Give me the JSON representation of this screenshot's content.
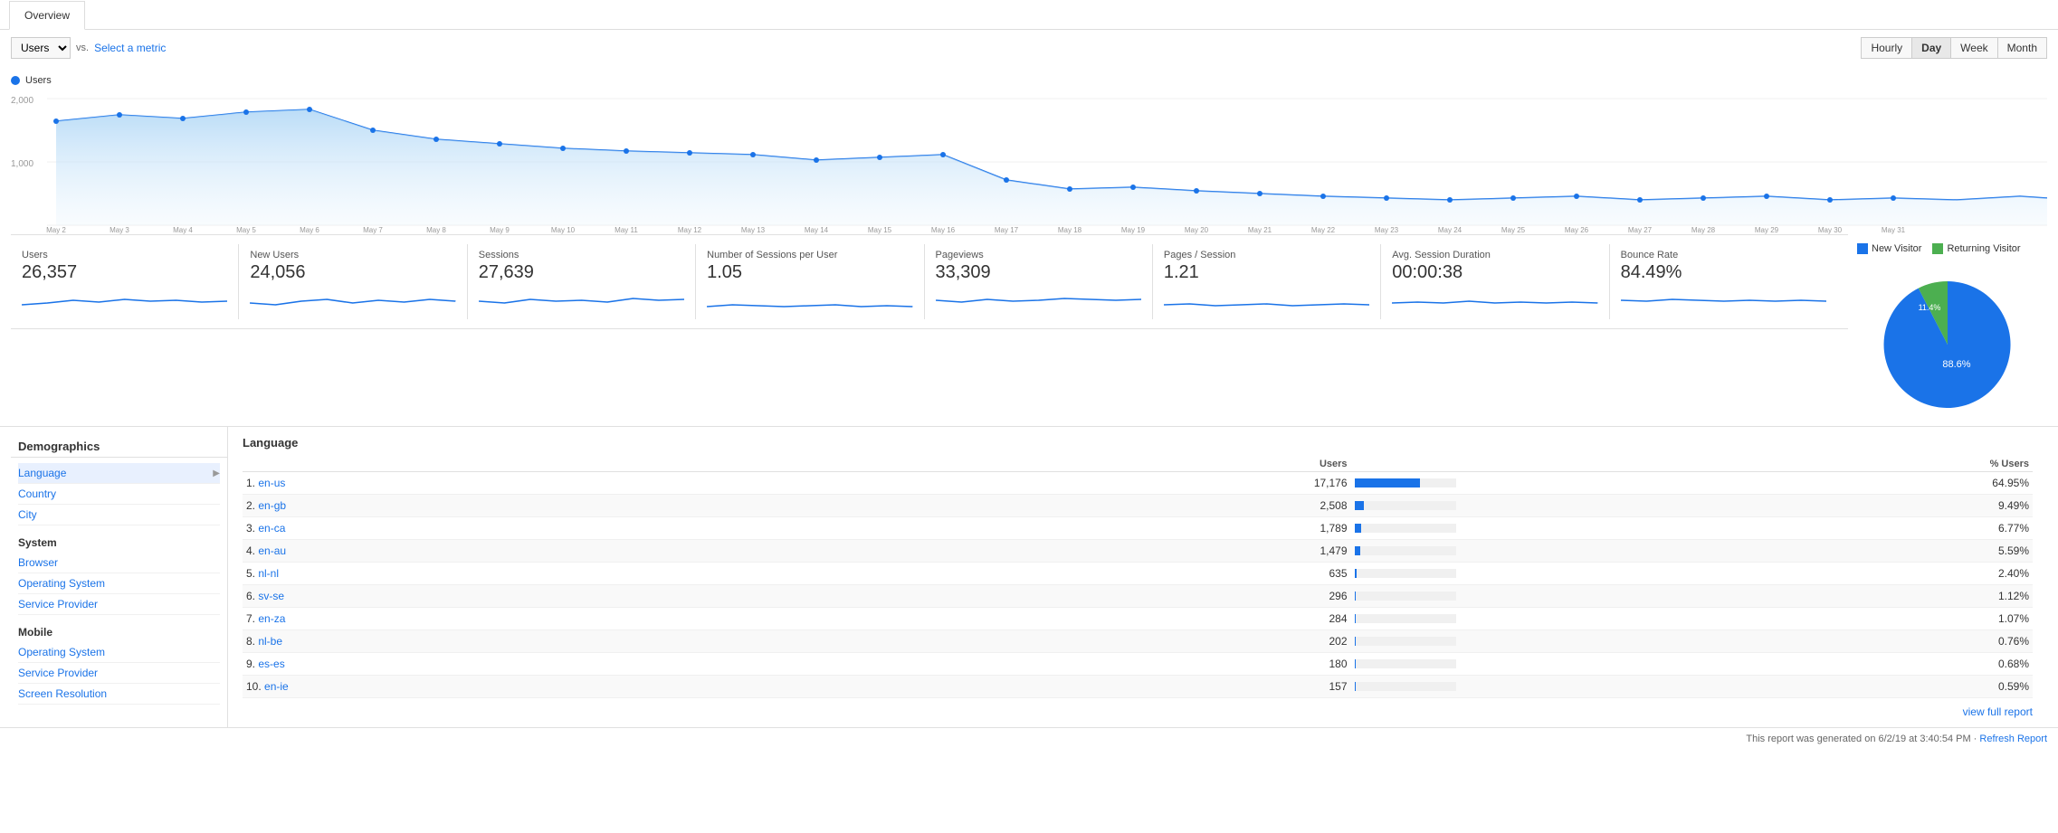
{
  "tabs": [
    {
      "label": "Overview",
      "active": true
    }
  ],
  "metric_selector": {
    "primary": "Users",
    "vs_label": "vs.",
    "select_metric_label": "Select a metric"
  },
  "time_buttons": [
    {
      "label": "Hourly",
      "active": false
    },
    {
      "label": "Day",
      "active": true
    },
    {
      "label": "Week",
      "active": false
    },
    {
      "label": "Month",
      "active": false
    }
  ],
  "chart": {
    "legend_label": "Users",
    "y_labels": [
      "2,000",
      "1,000"
    ],
    "x_labels": [
      "May 2",
      "May 3",
      "May 4",
      "May 5",
      "May 6",
      "May 7",
      "May 8",
      "May 9",
      "May 10",
      "May 11",
      "May 12",
      "May 13",
      "May 14",
      "May 15",
      "May 16",
      "May 17",
      "May 18",
      "May 19",
      "May 20",
      "May 21",
      "May 22",
      "May 23",
      "May 24",
      "May 25",
      "May 26",
      "May 27",
      "May 28",
      "May 29",
      "May 30",
      "May 31"
    ]
  },
  "metrics": [
    {
      "name": "Users",
      "value": "26,357"
    },
    {
      "name": "New Users",
      "value": "24,056"
    },
    {
      "name": "Sessions",
      "value": "27,639"
    },
    {
      "name": "Number of Sessions per User",
      "value": "1.05"
    },
    {
      "name": "Pageviews",
      "value": "33,309"
    },
    {
      "name": "Pages / Session",
      "value": "1.21"
    },
    {
      "name": "Avg. Session Duration",
      "value": "00:00:38"
    },
    {
      "name": "Bounce Rate",
      "value": "84.49%"
    }
  ],
  "visitor_legend": [
    {
      "label": "New Visitor",
      "color": "#1a73e8"
    },
    {
      "label": "Returning Visitor",
      "color": "#4caf50"
    }
  ],
  "pie": {
    "new_pct": 88.6,
    "returning_pct": 11.4,
    "new_label": "88.6%",
    "returning_label": "11.4%"
  },
  "demographics": {
    "title": "Demographics",
    "sections": [
      {
        "header": "Language",
        "items": [
          {
            "label": "Language",
            "active": true
          },
          {
            "label": "Country",
            "active": false
          },
          {
            "label": "City",
            "active": false
          }
        ]
      },
      {
        "header": "System",
        "items": [
          {
            "label": "Browser",
            "active": false
          },
          {
            "label": "Operating System",
            "active": false
          },
          {
            "label": "Service Provider",
            "active": false
          }
        ]
      },
      {
        "header": "Mobile",
        "items": [
          {
            "label": "Operating System",
            "active": false
          },
          {
            "label": "Service Provider",
            "active": false
          },
          {
            "label": "Screen Resolution",
            "active": false
          }
        ]
      }
    ]
  },
  "language_table": {
    "title": "Language",
    "headers": [
      "",
      "Users",
      "% Users"
    ],
    "rows": [
      {
        "rank": "1.",
        "lang": "en-us",
        "users": "17,176",
        "pct": "64.95%",
        "bar_pct": 64.95
      },
      {
        "rank": "2.",
        "lang": "en-gb",
        "users": "2,508",
        "pct": "9.49%",
        "bar_pct": 9.49
      },
      {
        "rank": "3.",
        "lang": "en-ca",
        "users": "1,789",
        "pct": "6.77%",
        "bar_pct": 6.77
      },
      {
        "rank": "4.",
        "lang": "en-au",
        "users": "1,479",
        "pct": "5.59%",
        "bar_pct": 5.59
      },
      {
        "rank": "5.",
        "lang": "nl-nl",
        "users": "635",
        "pct": "2.40%",
        "bar_pct": 2.4
      },
      {
        "rank": "6.",
        "lang": "sv-se",
        "users": "296",
        "pct": "1.12%",
        "bar_pct": 1.12
      },
      {
        "rank": "7.",
        "lang": "en-za",
        "users": "284",
        "pct": "1.07%",
        "bar_pct": 1.07
      },
      {
        "rank": "8.",
        "lang": "nl-be",
        "users": "202",
        "pct": "0.76%",
        "bar_pct": 0.76
      },
      {
        "rank": "9.",
        "lang": "es-es",
        "users": "180",
        "pct": "0.68%",
        "bar_pct": 0.68
      },
      {
        "rank": "10.",
        "lang": "en-ie",
        "users": "157",
        "pct": "0.59%",
        "bar_pct": 0.59
      }
    ],
    "view_full": "view full report"
  },
  "footer": {
    "text": "This report was generated on 6/2/19 at 3:40:54 PM · ",
    "refresh_label": "Refresh Report"
  }
}
